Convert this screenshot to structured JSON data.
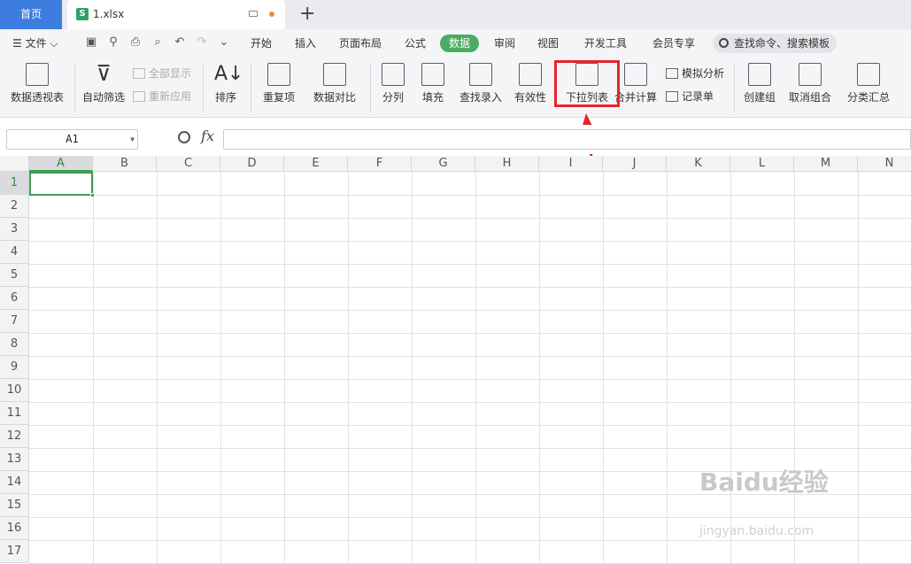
{
  "tabs": {
    "home": "首页",
    "file": "1.xlsx"
  },
  "menu": {
    "file": "文件",
    "items": [
      "开始",
      "插入",
      "页面布局",
      "公式",
      "数据",
      "审阅",
      "视图",
      "开发工具",
      "会员专享"
    ],
    "active": "数据",
    "search": "查找命令、搜索模板"
  },
  "ribbon": {
    "pivot": "数据透视表",
    "autofilter": "自动筛选",
    "show_all": "全部显示",
    "reapply": "重新应用",
    "sort": "排序",
    "dup": "重复项",
    "compare": "数据对比",
    "split": "分列",
    "fill": "填充",
    "lookup": "查找录入",
    "validity": "有效性",
    "dropdown": "下拉列表",
    "consolidate": "合并计算",
    "whatif": "模拟分析",
    "record": "记录单",
    "group": "创建组",
    "ungroup": "取消组合",
    "subtotal": "分类汇总"
  },
  "formula": {
    "cell_ref": "A1",
    "fx": "fx"
  },
  "columns": [
    "A",
    "B",
    "C",
    "D",
    "E",
    "F",
    "G",
    "H",
    "I",
    "J",
    "K",
    "L",
    "M",
    "N"
  ],
  "rows": [
    "1",
    "2",
    "3",
    "4",
    "5",
    "6",
    "7",
    "8",
    "9",
    "10",
    "11",
    "12",
    "13",
    "14",
    "15",
    "16",
    "17"
  ],
  "watermark": {
    "brand": "Baidu经验",
    "url": "jingyan.baidu.com"
  },
  "colors": {
    "accent": "#4cab62",
    "highlight": "#e8232b",
    "home_tab": "#3d7de0"
  }
}
